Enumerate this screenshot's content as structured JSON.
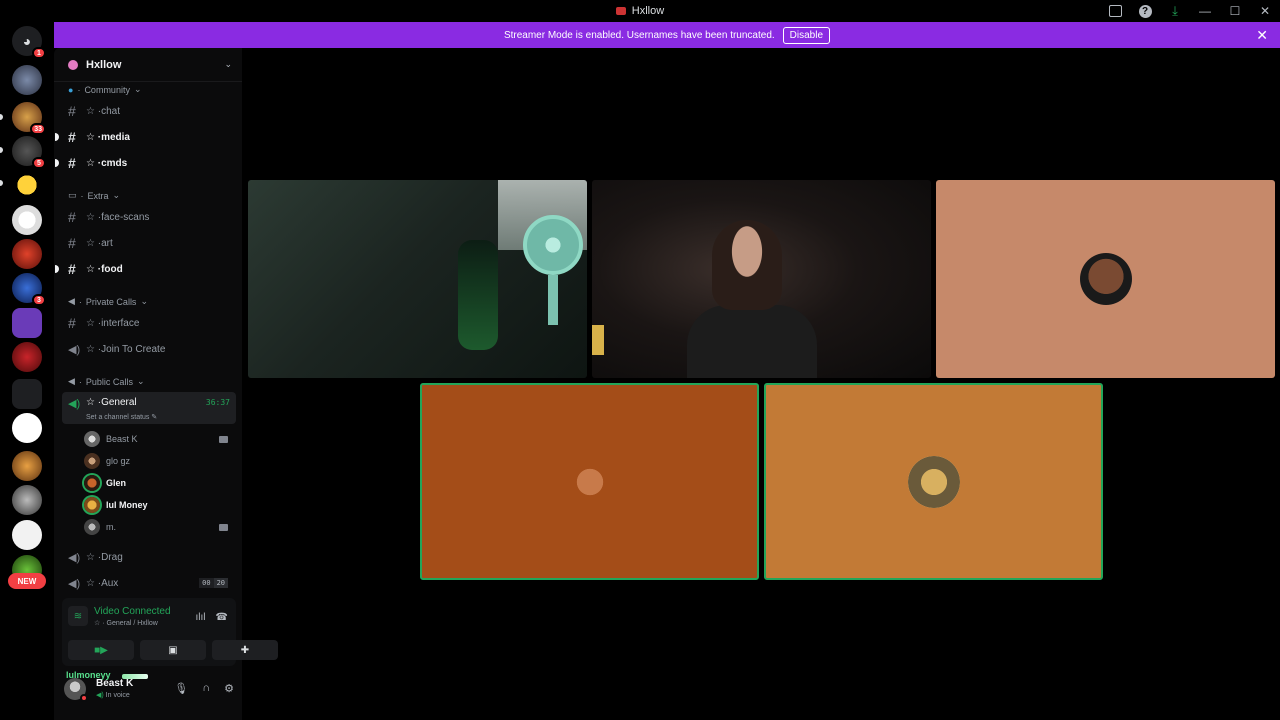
{
  "window": {
    "title": "Hxllow"
  },
  "banner": {
    "text": "Streamer Mode is enabled. Usernames have been truncated.",
    "button": "Disable"
  },
  "server": {
    "name": "Hxllow"
  },
  "rail": {
    "badges": [
      "1",
      "33",
      "5",
      "3"
    ],
    "new_label": "NEW"
  },
  "categories": {
    "community": "Community",
    "extra": "Extra",
    "private": "Private Calls",
    "public": "Public Calls"
  },
  "channels": {
    "chat": "chat",
    "media": "media",
    "cmds": "cmds",
    "face_scans": "face-scans",
    "art": "art",
    "food": "food",
    "interface": "interface",
    "join_to_create": "Join To Create",
    "general": "General",
    "drag": "Drag",
    "aux": "Aux"
  },
  "general": {
    "timer": "36:37",
    "status": "Set a channel status"
  },
  "voice_users": [
    "Beast K",
    "glo gz",
    "Glen",
    "lul Money",
    "m."
  ],
  "aux_counts": [
    "00",
    "20"
  ],
  "voice_panel": {
    "status": "Video Connected",
    "location": "General / Hxllow"
  },
  "user": {
    "floating_name": "lulmoneyy",
    "name": "Beast K",
    "status": "In voice"
  },
  "colors": {
    "accent": "#8a2be2",
    "green": "#23a559",
    "red": "#f23f43"
  }
}
